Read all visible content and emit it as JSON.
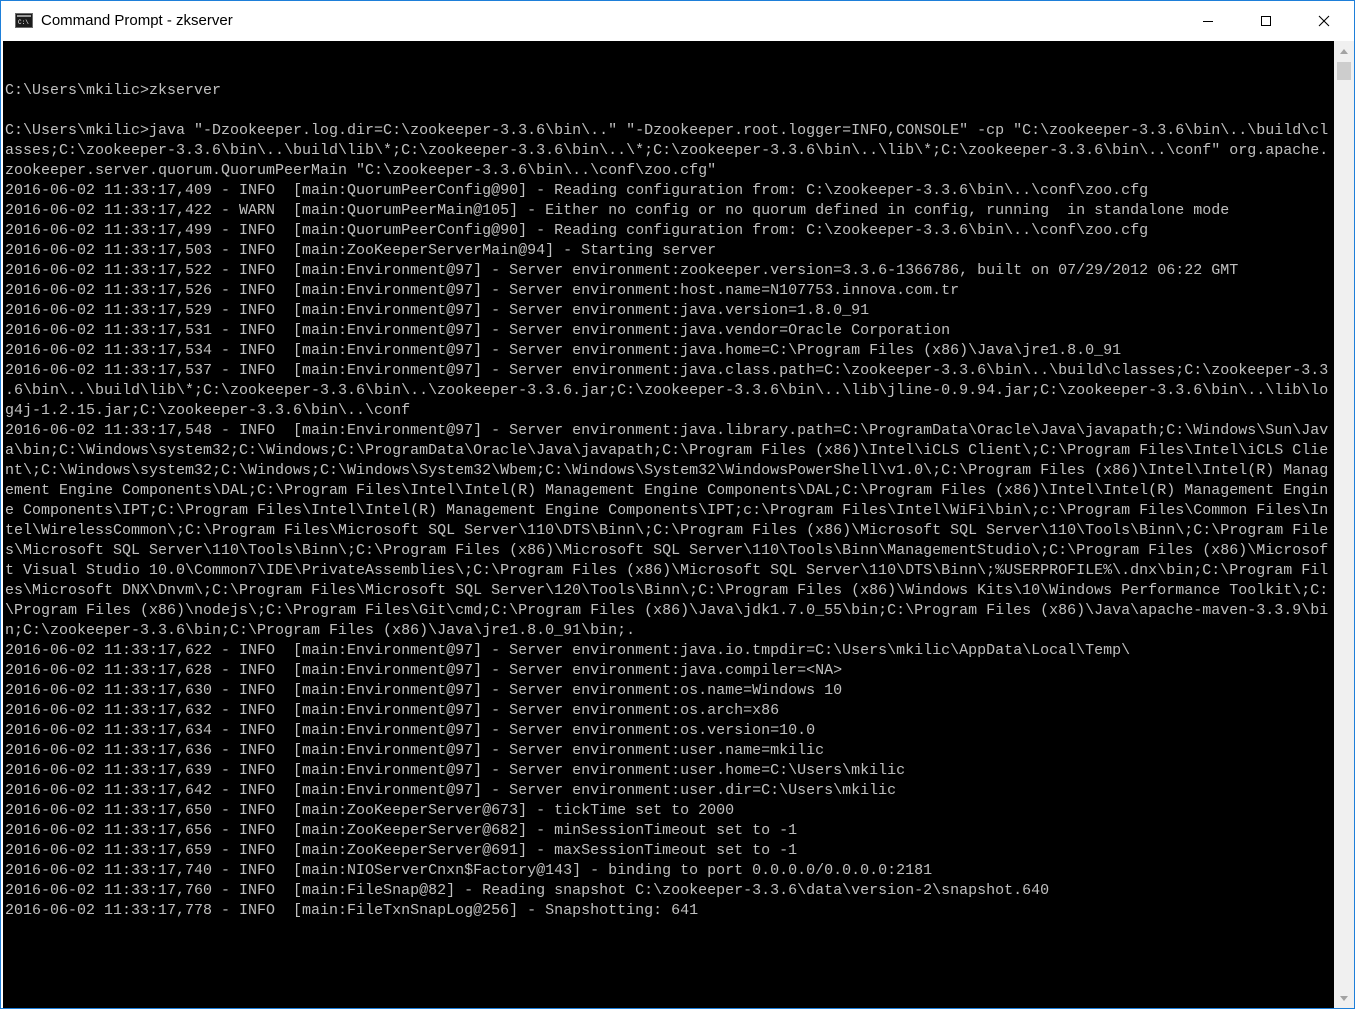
{
  "window": {
    "title": "Command Prompt - zkserver",
    "icon": "cmd-icon",
    "controls": {
      "minimize": "minimize-icon",
      "maximize": "maximize-icon",
      "close": "close-icon"
    }
  },
  "console": {
    "lines": [
      "",
      "C:\\Users\\mkilic>zkserver",
      "",
      "C:\\Users\\mkilic>java \"-Dzookeeper.log.dir=C:\\zookeeper-3.3.6\\bin\\..\" \"-Dzookeeper.root.logger=INFO,CONSOLE\" -cp \"C:\\zookeeper-3.3.6\\bin\\..\\build\\cl",
      "asses;C:\\zookeeper-3.3.6\\bin\\..\\build\\lib\\*;C:\\zookeeper-3.3.6\\bin\\..\\*;C:\\zookeeper-3.3.6\\bin\\..\\lib\\*;C:\\zookeeper-3.3.6\\bin\\..\\conf\" org.apache.",
      "zookeeper.server.quorum.QuorumPeerMain \"C:\\zookeeper-3.3.6\\bin\\..\\conf\\zoo.cfg\"",
      "2016-06-02 11:33:17,409 - INFO  [main:QuorumPeerConfig@90] - Reading configuration from: C:\\zookeeper-3.3.6\\bin\\..\\conf\\zoo.cfg",
      "2016-06-02 11:33:17,422 - WARN  [main:QuorumPeerMain@105] - Either no config or no quorum defined in config, running  in standalone mode",
      "2016-06-02 11:33:17,499 - INFO  [main:QuorumPeerConfig@90] - Reading configuration from: C:\\zookeeper-3.3.6\\bin\\..\\conf\\zoo.cfg",
      "2016-06-02 11:33:17,503 - INFO  [main:ZooKeeperServerMain@94] - Starting server",
      "2016-06-02 11:33:17,522 - INFO  [main:Environment@97] - Server environment:zookeeper.version=3.3.6-1366786, built on 07/29/2012 06:22 GMT",
      "2016-06-02 11:33:17,526 - INFO  [main:Environment@97] - Server environment:host.name=N107753.innova.com.tr",
      "2016-06-02 11:33:17,529 - INFO  [main:Environment@97] - Server environment:java.version=1.8.0_91",
      "2016-06-02 11:33:17,531 - INFO  [main:Environment@97] - Server environment:java.vendor=Oracle Corporation",
      "2016-06-02 11:33:17,534 - INFO  [main:Environment@97] - Server environment:java.home=C:\\Program Files (x86)\\Java\\jre1.8.0_91",
      "2016-06-02 11:33:17,537 - INFO  [main:Environment@97] - Server environment:java.class.path=C:\\zookeeper-3.3.6\\bin\\..\\build\\classes;C:\\zookeeper-3.3",
      ".6\\bin\\..\\build\\lib\\*;C:\\zookeeper-3.3.6\\bin\\..\\zookeeper-3.3.6.jar;C:\\zookeeper-3.3.6\\bin\\..\\lib\\jline-0.9.94.jar;C:\\zookeeper-3.3.6\\bin\\..\\lib\\lo",
      "g4j-1.2.15.jar;C:\\zookeeper-3.3.6\\bin\\..\\conf",
      "2016-06-02 11:33:17,548 - INFO  [main:Environment@97] - Server environment:java.library.path=C:\\ProgramData\\Oracle\\Java\\javapath;C:\\Windows\\Sun\\Jav",
      "a\\bin;C:\\Windows\\system32;C:\\Windows;C:\\ProgramData\\Oracle\\Java\\javapath;C:\\Program Files (x86)\\Intel\\iCLS Client\\;C:\\Program Files\\Intel\\iCLS Clie",
      "nt\\;C:\\Windows\\system32;C:\\Windows;C:\\Windows\\System32\\Wbem;C:\\Windows\\System32\\WindowsPowerShell\\v1.0\\;C:\\Program Files (x86)\\Intel\\Intel(R) Manag",
      "ement Engine Components\\DAL;C:\\Program Files\\Intel\\Intel(R) Management Engine Components\\DAL;C:\\Program Files (x86)\\Intel\\Intel(R) Management Engin",
      "e Components\\IPT;C:\\Program Files\\Intel\\Intel(R) Management Engine Components\\IPT;c:\\Program Files\\Intel\\WiFi\\bin\\;c:\\Program Files\\Common Files\\In",
      "tel\\WirelessCommon\\;C:\\Program Files\\Microsoft SQL Server\\110\\DTS\\Binn\\;C:\\Program Files (x86)\\Microsoft SQL Server\\110\\Tools\\Binn\\;C:\\Program File",
      "s\\Microsoft SQL Server\\110\\Tools\\Binn\\;C:\\Program Files (x86)\\Microsoft SQL Server\\110\\Tools\\Binn\\ManagementStudio\\;C:\\Program Files (x86)\\Microsof",
      "t Visual Studio 10.0\\Common7\\IDE\\PrivateAssemblies\\;C:\\Program Files (x86)\\Microsoft SQL Server\\110\\DTS\\Binn\\;%USERPROFILE%\\.dnx\\bin;C:\\Program Fil",
      "es\\Microsoft DNX\\Dnvm\\;C:\\Program Files\\Microsoft SQL Server\\120\\Tools\\Binn\\;C:\\Program Files (x86)\\Windows Kits\\10\\Windows Performance Toolkit\\;C:",
      "\\Program Files (x86)\\nodejs\\;C:\\Program Files\\Git\\cmd;C:\\Program Files (x86)\\Java\\jdk1.7.0_55\\bin;C:\\Program Files (x86)\\Java\\apache-maven-3.3.9\\bi",
      "n;C:\\zookeeper-3.3.6\\bin;C:\\Program Files (x86)\\Java\\jre1.8.0_91\\bin;.",
      "2016-06-02 11:33:17,622 - INFO  [main:Environment@97] - Server environment:java.io.tmpdir=C:\\Users\\mkilic\\AppData\\Local\\Temp\\",
      "2016-06-02 11:33:17,628 - INFO  [main:Environment@97] - Server environment:java.compiler=<NA>",
      "2016-06-02 11:33:17,630 - INFO  [main:Environment@97] - Server environment:os.name=Windows 10",
      "2016-06-02 11:33:17,632 - INFO  [main:Environment@97] - Server environment:os.arch=x86",
      "2016-06-02 11:33:17,634 - INFO  [main:Environment@97] - Server environment:os.version=10.0",
      "2016-06-02 11:33:17,636 - INFO  [main:Environment@97] - Server environment:user.name=mkilic",
      "2016-06-02 11:33:17,639 - INFO  [main:Environment@97] - Server environment:user.home=C:\\Users\\mkilic",
      "2016-06-02 11:33:17,642 - INFO  [main:Environment@97] - Server environment:user.dir=C:\\Users\\mkilic",
      "2016-06-02 11:33:17,650 - INFO  [main:ZooKeeperServer@673] - tickTime set to 2000",
      "2016-06-02 11:33:17,656 - INFO  [main:ZooKeeperServer@682] - minSessionTimeout set to -1",
      "2016-06-02 11:33:17,659 - INFO  [main:ZooKeeperServer@691] - maxSessionTimeout set to -1",
      "2016-06-02 11:33:17,740 - INFO  [main:NIOServerCnxn$Factory@143] - binding to port 0.0.0.0/0.0.0.0:2181",
      "2016-06-02 11:33:17,760 - INFO  [main:FileSnap@82] - Reading snapshot C:\\zookeeper-3.3.6\\data\\version-2\\snapshot.640",
      "2016-06-02 11:33:17,778 - INFO  [main:FileTxnSnapLog@256] - Snapshotting: 641"
    ]
  },
  "scrollbar": {
    "up": "scroll-up-arrow-icon",
    "down": "scroll-down-arrow-icon"
  },
  "colors": {
    "background": "#000000",
    "text": "#c0c0c0",
    "titlebar": "#ffffff",
    "border": "#1e7fd9"
  }
}
